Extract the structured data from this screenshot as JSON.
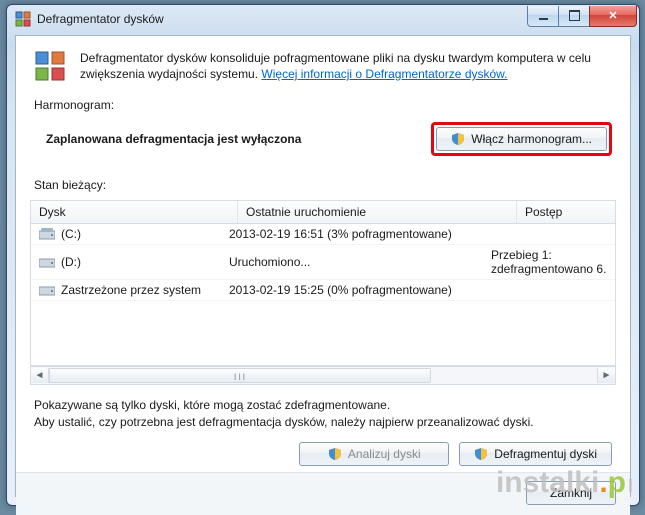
{
  "window": {
    "title": "Defragmentator dysków"
  },
  "description": {
    "text": "Defragmentator dysków konsoliduje pofragmentowane pliki na dysku twardym komputera w celu zwiększenia wydajności systemu. ",
    "link": "Więcej informacji o Defragmentatorze dysków."
  },
  "schedule": {
    "label": "Harmonogram:",
    "status": "Zaplanowana defragmentacja jest wyłączona",
    "button": "Włącz harmonogram..."
  },
  "current": {
    "label": "Stan bieżący:",
    "columns": {
      "disk": "Dysk",
      "last": "Ostatnie uruchomienie",
      "progress": "Postęp"
    },
    "rows": [
      {
        "disk": "(C:)",
        "last": "2013-02-19 16:51 (3% pofragmentowane)",
        "progress": ""
      },
      {
        "disk": "(D:)",
        "last": "Uruchomiono...",
        "progress": "Przebieg 1: zdefragmentowano 6."
      },
      {
        "disk": "Zastrzeżone przez system",
        "last": "2013-02-19 15:25 (0% pofragmentowane)",
        "progress": ""
      }
    ]
  },
  "footer": {
    "note1": "Pokazywane są tylko dyski, które mogą zostać zdefragmentowane.",
    "note2": "Aby ustalić, czy potrzebna jest defragmentacja dysków, należy najpierw przeanalizować dyski.",
    "analyze": "Analizuj dyski",
    "defrag": "Defragmentuj dyski",
    "close": "Zamknij"
  },
  "watermark": {
    "a": "instalki",
    "b": ".",
    "c": "p",
    "d": "l"
  }
}
